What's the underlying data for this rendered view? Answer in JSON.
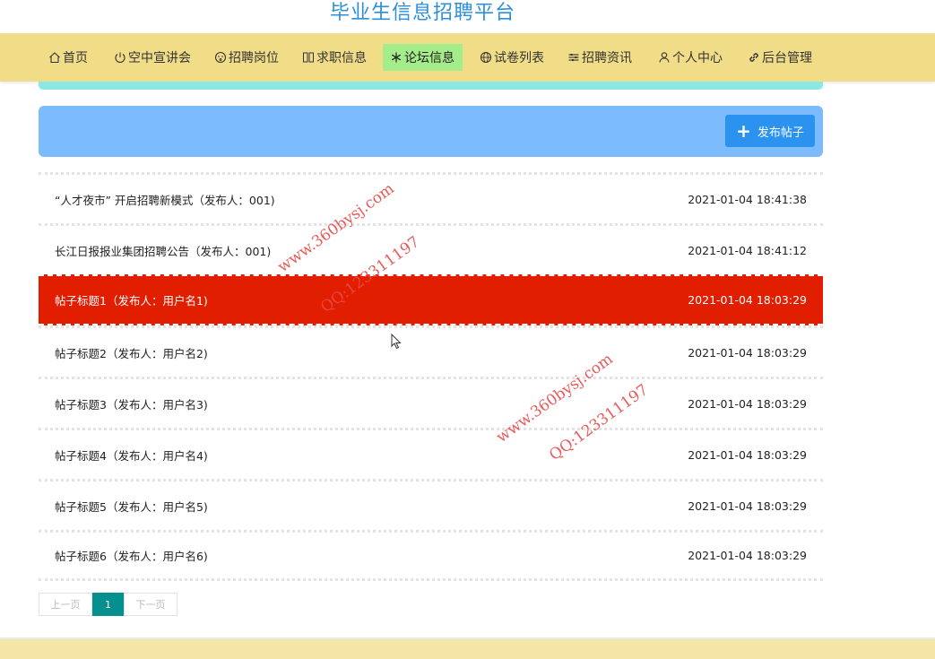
{
  "site": {
    "title": "毕业生信息招聘平台"
  },
  "nav": {
    "items": [
      {
        "label": "首页",
        "icon": "home-icon"
      },
      {
        "label": "空中宣讲会",
        "icon": "power-icon"
      },
      {
        "label": "招聘岗位",
        "icon": "face-icon"
      },
      {
        "label": "求职信息",
        "icon": "columns-icon"
      },
      {
        "label": "论坛信息",
        "icon": "snowflake-icon",
        "active": true
      },
      {
        "label": "试卷列表",
        "icon": "globe-icon"
      },
      {
        "label": "招聘资讯",
        "icon": "sliders-icon"
      },
      {
        "label": "个人中心",
        "icon": "user-icon"
      },
      {
        "label": "后台管理",
        "icon": "link-icon"
      }
    ]
  },
  "toolbar": {
    "publish_label": "发布帖子"
  },
  "posts": [
    {
      "title": "“人才夜市” 开启招聘新模式（发布人：001)",
      "time": "2021-01-04 18:41:38"
    },
    {
      "title": "长江日报报业集团招聘公告（发布人：001)",
      "time": "2021-01-04 18:41:12"
    },
    {
      "title": "帖子标题1（发布人：用户名1)",
      "time": "2021-01-04 18:03:29",
      "highlighted": true
    },
    {
      "title": "帖子标题2（发布人：用户名2)",
      "time": "2021-01-04 18:03:29"
    },
    {
      "title": "帖子标题3（发布人：用户名3)",
      "time": "2021-01-04 18:03:29"
    },
    {
      "title": "帖子标题4（发布人：用户名4)",
      "time": "2021-01-04 18:03:29"
    },
    {
      "title": "帖子标题5（发布人：用户名5)",
      "time": "2021-01-04 18:03:29"
    },
    {
      "title": "帖子标题6（发布人：用户名6)",
      "time": "2021-01-04 18:03:29"
    }
  ],
  "pager": {
    "prev_label": "上一页",
    "current_page": "1",
    "next_label": "下一页"
  },
  "watermarks": {
    "url_text": "www.360bysj.com",
    "qq_text": "QQ:123311197"
  },
  "colors": {
    "navbar": "#f1dd88",
    "active_nav": "#a5ec8a",
    "toolbar": "#7dbbff",
    "publish_button": "#2b93ef",
    "highlight_row": "#e11e00",
    "current_page": "#05908f",
    "title": "#2d8fd8"
  }
}
